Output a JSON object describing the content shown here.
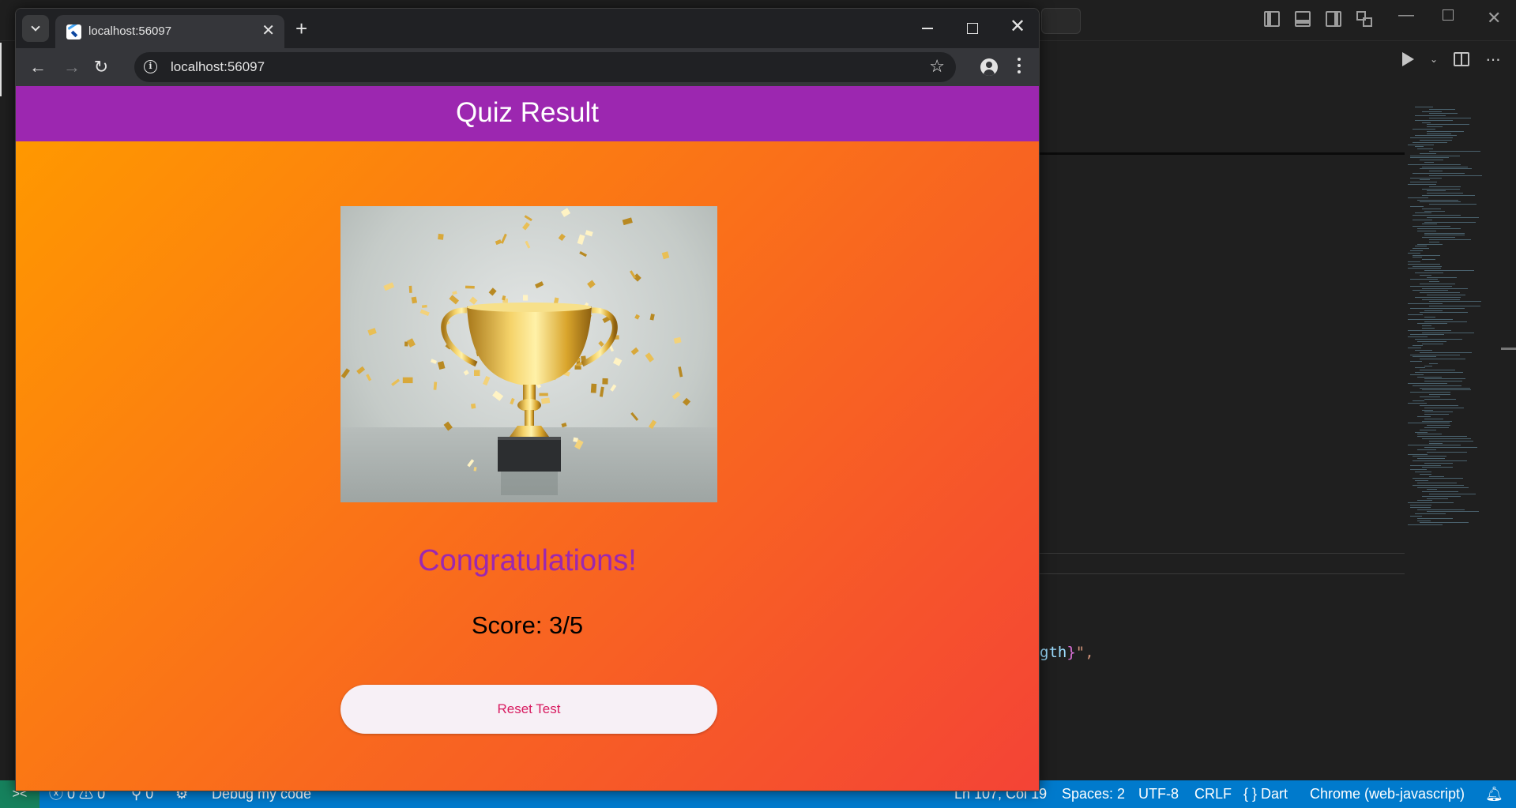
{
  "browser": {
    "tab_title": "localhost:56097",
    "url": "localhost:56097",
    "new_tab_symbol": "+",
    "close_symbol": "✕"
  },
  "app": {
    "appbar_title": "Quiz Result",
    "congrats_text": "Congratulations!",
    "score_text": "Score: 3/5",
    "reset_button_label": "Reset Test",
    "colors": {
      "appbar": "#9c27b0",
      "gradient_start": "#ff9800",
      "gradient_end": "#f44336",
      "congrats_text": "#9c27b0",
      "button_text": "#d81b60"
    }
  },
  "editor": {
    "code_fragment_var": "gth",
    "code_fragment_brace": "}",
    "code_fragment_tail": "\",",
    "status_bar": {
      "errors": "0",
      "warnings": "0",
      "ports": "0",
      "debug_label": "Debug my code",
      "cursor_position": "Ln 107, Col 19",
      "indentation": "Spaces: 2",
      "encoding": "UTF-8",
      "line_ending": "CRLF",
      "language": "Dart",
      "language_icon": "{ }",
      "device": "Chrome (web-javascript)"
    }
  },
  "icons": [
    "tab-search-icon",
    "flutter-favicon",
    "close-icon",
    "new-tab-icon",
    "back-icon",
    "forward-icon",
    "reload-icon",
    "info-icon",
    "bookmark-star-icon",
    "profile-icon",
    "more-menu-icon",
    "trophy-image",
    "notification-bell-icon",
    "run-icon",
    "split-editor-icon"
  ]
}
